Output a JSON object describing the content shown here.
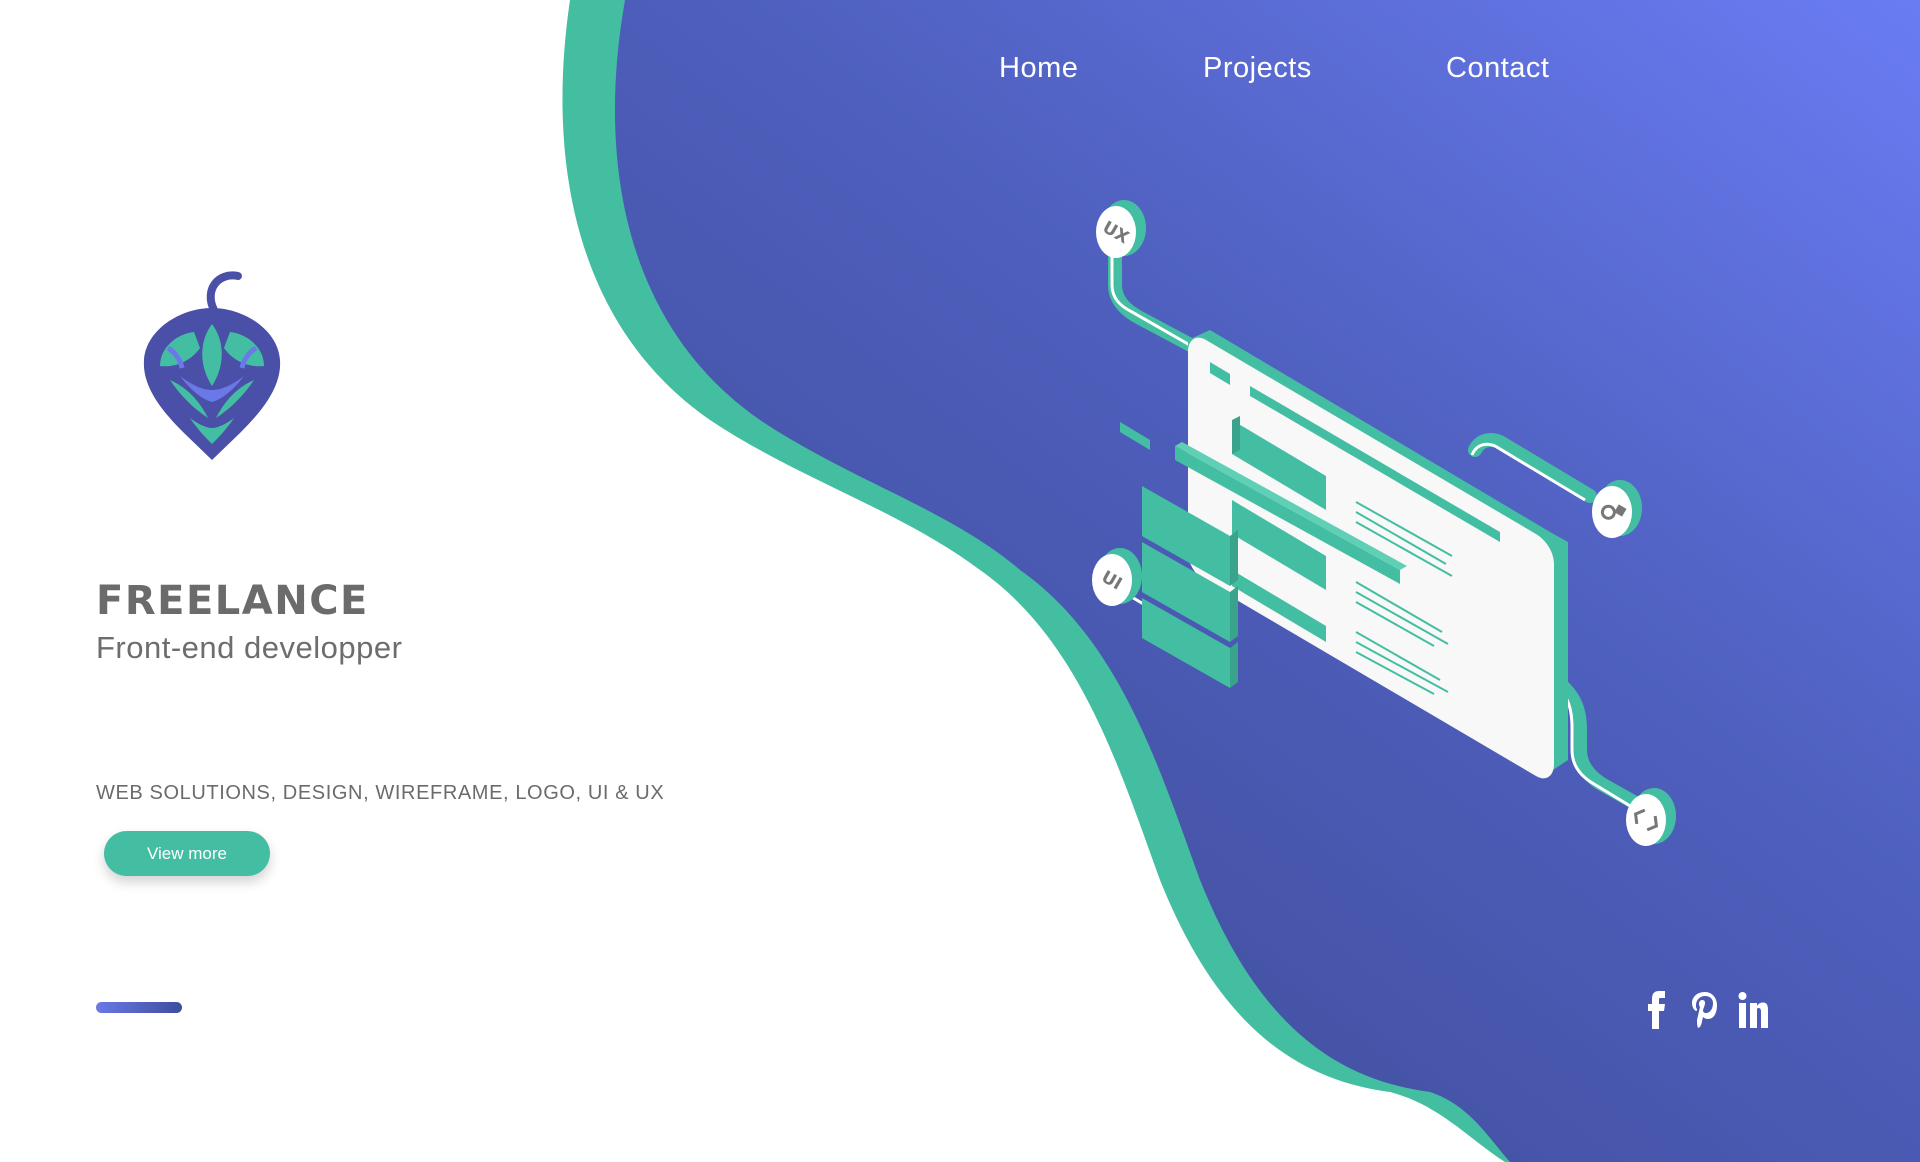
{
  "nav": {
    "items": [
      {
        "label": "Home"
      },
      {
        "label": "Projects"
      },
      {
        "label": "Contact"
      }
    ]
  },
  "hero": {
    "title": "FREELANCE",
    "subtitle": "Front-end developper",
    "services": "WEB SOLUTIONS, DESIGN, WIREFRAME, LOGO, UI & UX",
    "button_label": "View more"
  },
  "illustration": {
    "nodes": [
      {
        "label": "UX"
      },
      {
        "label": "UI"
      }
    ]
  },
  "social": {
    "icons": [
      "facebook-icon",
      "pinterest-icon",
      "linkedin-icon"
    ]
  },
  "colors": {
    "accent_green": "#44bea2",
    "gradient_top": "#6a7af0",
    "gradient_bottom": "#3f4b96",
    "text_gray": "#6b6b6b",
    "logo_blue": "#4a4fa8"
  }
}
